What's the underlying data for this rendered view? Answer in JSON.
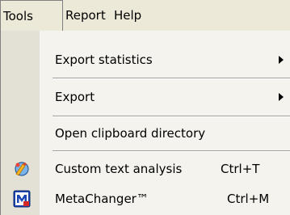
{
  "menubar": {
    "items": [
      {
        "label": "Tools",
        "active": true
      },
      {
        "label": "Report"
      },
      {
        "label": "Help"
      }
    ]
  },
  "menu": {
    "items": [
      {
        "label": "Export statistics",
        "submenu": true
      },
      {
        "label": "Export",
        "submenu": true
      },
      {
        "label": "Open clipboard directory"
      },
      {
        "label": "Custom text analysis",
        "shortcut": "Ctrl+T",
        "icon": "custom-text-analysis-icon"
      },
      {
        "label": "MetaChanger™",
        "shortcut": "Ctrl+M",
        "icon": "metachanger-icon"
      }
    ]
  }
}
